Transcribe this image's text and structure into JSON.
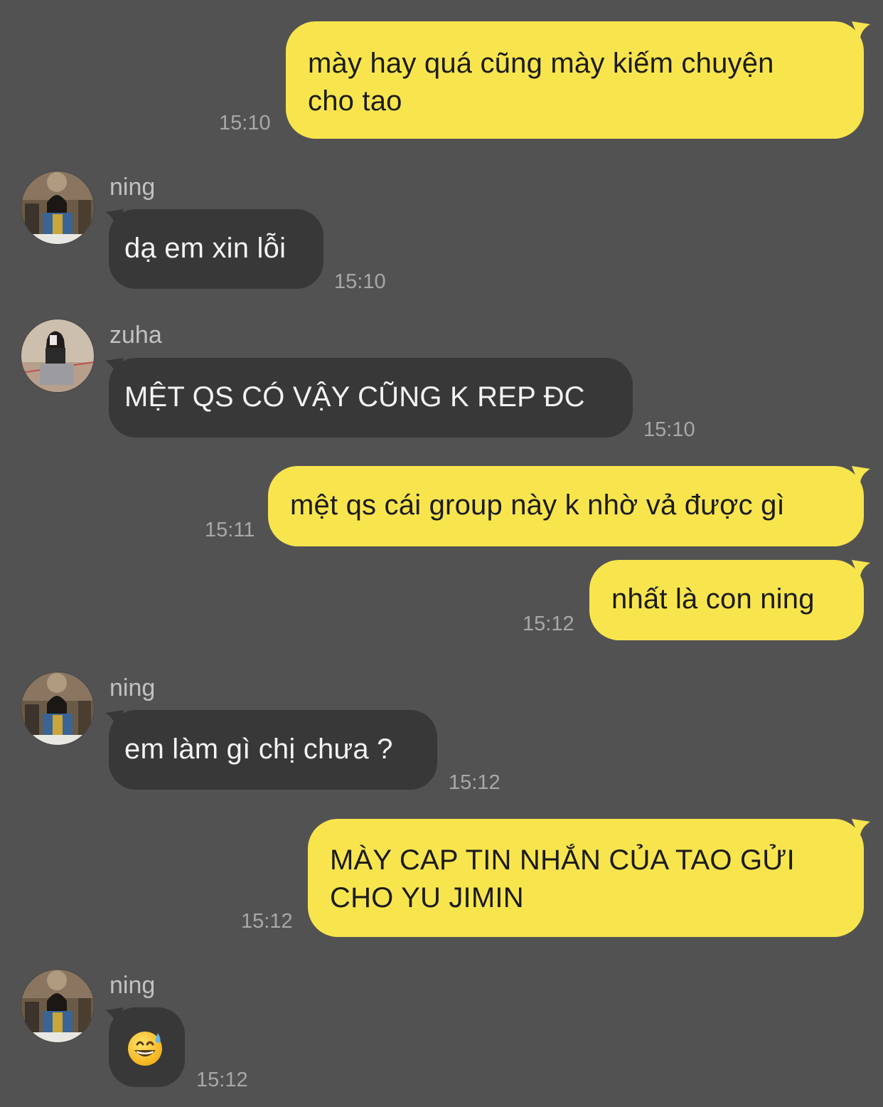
{
  "chat": {
    "messages": [
      {
        "sender": "me",
        "text": "mày hay quá cũng mày kiếm chuyện\ncho tao",
        "time": "15:10"
      },
      {
        "sender": "ning",
        "text": "dạ em xin lỗi",
        "time": "15:10"
      },
      {
        "sender": "zuha",
        "text": "MỆT QS CÓ VẬY CŨNG K REP ĐC",
        "time": "15:10"
      },
      {
        "sender": "me",
        "text": "mệt qs cái group này k nhờ vả được gì",
        "time": "15:11"
      },
      {
        "sender": "me",
        "text": "nhất là con ning",
        "time": "15:12"
      },
      {
        "sender": "ning",
        "text": "em làm gì chị chưa ?",
        "time": "15:12"
      },
      {
        "sender": "me",
        "text": "MÀY CAP TIN NHẮN CỦA TAO GỬI\nCHO YU JIMIN",
        "time": "15:12"
      },
      {
        "sender": "ning",
        "text": "😅",
        "time": "15:12"
      }
    ]
  },
  "colors": {
    "background": "#535253",
    "outgoing_bubble": "#f8e54e",
    "incoming_bubble": "#393839",
    "timestamp": "#a9a8a9",
    "sender_name": "#c2c1c2"
  }
}
